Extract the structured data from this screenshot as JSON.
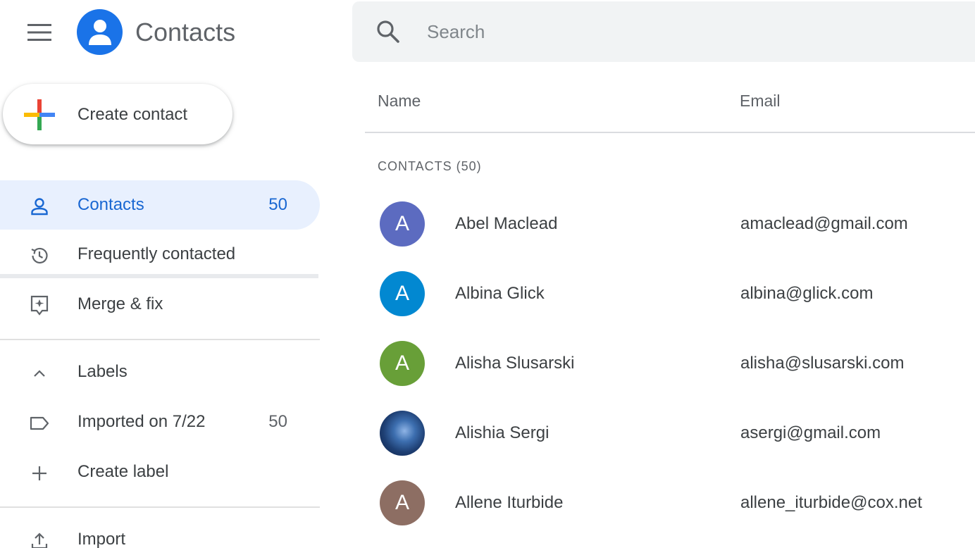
{
  "app": {
    "title": "Contacts",
    "brand_color": "#1a73e8",
    "menu_icon": "hamburger-menu-icon",
    "logo_icon": "person-icon"
  },
  "search": {
    "placeholder": "Search",
    "value": "",
    "icon": "search-icon"
  },
  "sidebar": {
    "create_label": "Create contact",
    "create_icon": "multicolor-plus-icon",
    "items": [
      {
        "label": "Contacts",
        "count": "50",
        "icon": "person-outline-icon",
        "active": true
      },
      {
        "label": "Frequently contacted",
        "count": "",
        "icon": "history-icon",
        "active": false
      },
      {
        "label": "Merge & fix",
        "count": "",
        "icon": "merge-fix-icon",
        "active": false
      }
    ],
    "labels_header": {
      "label": "Labels",
      "icon": "chevron-up-icon"
    },
    "labels": [
      {
        "label": "Imported on 7/22",
        "count": "50",
        "icon": "label-tag-icon"
      }
    ],
    "create_label_item": {
      "label": "Create label",
      "icon": "plus-icon"
    },
    "import_item": {
      "label": "Import",
      "icon": "upload-icon"
    }
  },
  "table": {
    "columns": [
      "Name",
      "Email"
    ],
    "section_label": "CONTACTS (50)",
    "rows": [
      {
        "initial": "A",
        "name": "Abel Maclead",
        "email": "amaclead@gmail.com",
        "avatar_color": "#5c6bc0",
        "photo": false
      },
      {
        "initial": "A",
        "name": "Albina Glick",
        "email": "albina@glick.com",
        "avatar_color": "#0288d1",
        "photo": false
      },
      {
        "initial": "A",
        "name": "Alisha Slusarski",
        "email": "alisha@slusarski.com",
        "avatar_color": "#689f38",
        "photo": false
      },
      {
        "initial": "",
        "name": "Alishia Sergi",
        "email": "asergi@gmail.com",
        "avatar_color": "#1e3f73",
        "photo": true
      },
      {
        "initial": "A",
        "name": "Allene Iturbide",
        "email": "allene_iturbide@cox.net",
        "avatar_color": "#8d6e63",
        "photo": false
      }
    ]
  }
}
